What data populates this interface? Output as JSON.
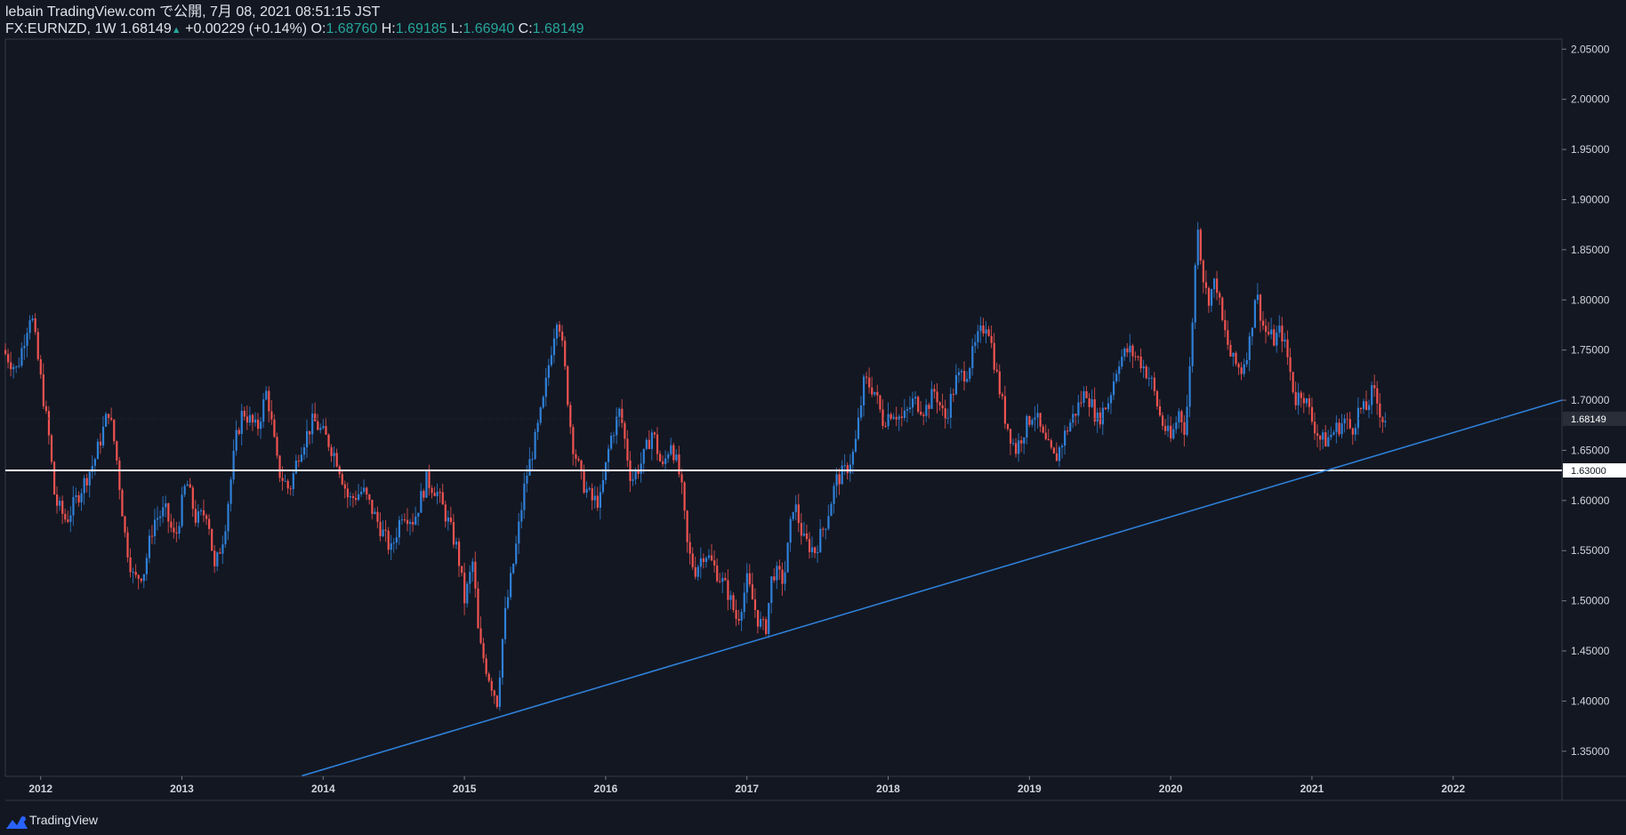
{
  "header": {
    "publish_line": "lebain TradingView.com で公開, 7月 08, 2021 08:51:15 JST",
    "symbol": "FX:EURNZD, 1W",
    "last": "1.68149",
    "change": "+0.00229 (+0.14%)",
    "o_label": "O:",
    "o_value": "1.68760",
    "h_label": "H:",
    "h_value": "1.69185",
    "l_label": "L:",
    "l_value": "1.66940",
    "c_label": "C:",
    "c_value": "1.68149"
  },
  "footer": {
    "brand": "TradingView",
    "brand_icon": "tradingview-logo-icon"
  },
  "colors": {
    "background": "#131722",
    "up": "#2f80d8",
    "down": "#ef5350",
    "trendline": "#2f80d8",
    "hline": "#ffffff",
    "text": "#d1d4dc",
    "accent": "#26a69a"
  },
  "chart_data": {
    "type": "candlestick",
    "y_scale": "linear",
    "ylim": [
      1.325,
      2.06
    ],
    "x_domain": [
      2011.75,
      2022.77
    ],
    "grid": false,
    "yticks": [
      "2.05000",
      "2.00000",
      "1.95000",
      "1.90000",
      "1.85000",
      "1.80000",
      "1.75000",
      "1.70000",
      "1.65000",
      "1.60000",
      "1.55000",
      "1.50000",
      "1.45000",
      "1.40000",
      "1.35000"
    ],
    "ytick_values": [
      2.05,
      2.0,
      1.95,
      1.9,
      1.85,
      1.8,
      1.75,
      1.7,
      1.65,
      1.6,
      1.55,
      1.5,
      1.45,
      1.4,
      1.35
    ],
    "xticks": [
      "2012",
      "2013",
      "2014",
      "2015",
      "2016",
      "2017",
      "2018",
      "2019",
      "2020",
      "2021",
      "2022"
    ],
    "xtick_values": [
      2012,
      2013,
      2014,
      2015,
      2016,
      2017,
      2018,
      2019,
      2020,
      2021,
      2022
    ],
    "last_price": 1.68149,
    "last_price_label": "1.68149",
    "horizontal_line": {
      "price": 1.63,
      "label": "1.63000"
    },
    "trendline": {
      "x1": 2013.85,
      "y1": 1.3255,
      "x2": 2022.77,
      "y2": 1.7
    },
    "price_path": [
      [
        2011.75,
        1.75
      ],
      [
        2011.85,
        1.73
      ],
      [
        2011.95,
        1.79
      ],
      [
        2012.02,
        1.72
      ],
      [
        2012.08,
        1.66
      ],
      [
        2012.12,
        1.6
      ],
      [
        2012.2,
        1.58
      ],
      [
        2012.3,
        1.61
      ],
      [
        2012.4,
        1.64
      ],
      [
        2012.5,
        1.69
      ],
      [
        2012.55,
        1.65
      ],
      [
        2012.62,
        1.56
      ],
      [
        2012.68,
        1.52
      ],
      [
        2012.75,
        1.53
      ],
      [
        2012.82,
        1.58
      ],
      [
        2012.9,
        1.59
      ],
      [
        2012.97,
        1.56
      ],
      [
        2013.05,
        1.62
      ],
      [
        2013.12,
        1.58
      ],
      [
        2013.2,
        1.59
      ],
      [
        2013.25,
        1.53
      ],
      [
        2013.32,
        1.57
      ],
      [
        2013.4,
        1.66
      ],
      [
        2013.45,
        1.69
      ],
      [
        2013.55,
        1.67
      ],
      [
        2013.62,
        1.71
      ],
      [
        2013.7,
        1.63
      ],
      [
        2013.78,
        1.61
      ],
      [
        2013.85,
        1.65
      ],
      [
        2013.95,
        1.68
      ],
      [
        2014.05,
        1.66
      ],
      [
        2014.12,
        1.64
      ],
      [
        2014.2,
        1.6
      ],
      [
        2014.3,
        1.61
      ],
      [
        2014.4,
        1.58
      ],
      [
        2014.5,
        1.55
      ],
      [
        2014.58,
        1.59
      ],
      [
        2014.66,
        1.58
      ],
      [
        2014.75,
        1.62
      ],
      [
        2014.82,
        1.61
      ],
      [
        2014.9,
        1.58
      ],
      [
        2014.97,
        1.55
      ],
      [
        2015.02,
        1.5
      ],
      [
        2015.08,
        1.54
      ],
      [
        2015.12,
        1.46
      ],
      [
        2015.18,
        1.43
      ],
      [
        2015.25,
        1.4
      ],
      [
        2015.3,
        1.48
      ],
      [
        2015.38,
        1.55
      ],
      [
        2015.45,
        1.62
      ],
      [
        2015.52,
        1.66
      ],
      [
        2015.58,
        1.7
      ],
      [
        2015.62,
        1.74
      ],
      [
        2015.68,
        1.79
      ],
      [
        2015.73,
        1.73
      ],
      [
        2015.78,
        1.66
      ],
      [
        2015.85,
        1.62
      ],
      [
        2015.92,
        1.6
      ],
      [
        2015.98,
        1.6
      ],
      [
        2016.05,
        1.66
      ],
      [
        2016.12,
        1.69
      ],
      [
        2016.2,
        1.62
      ],
      [
        2016.28,
        1.64
      ],
      [
        2016.35,
        1.67
      ],
      [
        2016.42,
        1.63
      ],
      [
        2016.48,
        1.66
      ],
      [
        2016.55,
        1.62
      ],
      [
        2016.6,
        1.55
      ],
      [
        2016.65,
        1.53
      ],
      [
        2016.72,
        1.55
      ],
      [
        2016.8,
        1.53
      ],
      [
        2016.88,
        1.51
      ],
      [
        2016.95,
        1.48
      ],
      [
        2017.02,
        1.52
      ],
      [
        2017.1,
        1.48
      ],
      [
        2017.15,
        1.47
      ],
      [
        2017.2,
        1.53
      ],
      [
        2017.28,
        1.52
      ],
      [
        2017.35,
        1.6
      ],
      [
        2017.42,
        1.56
      ],
      [
        2017.5,
        1.55
      ],
      [
        2017.58,
        1.58
      ],
      [
        2017.65,
        1.62
      ],
      [
        2017.72,
        1.63
      ],
      [
        2017.78,
        1.65
      ],
      [
        2017.85,
        1.72
      ],
      [
        2017.92,
        1.71
      ],
      [
        2017.98,
        1.68
      ],
      [
        2018.05,
        1.69
      ],
      [
        2018.12,
        1.68
      ],
      [
        2018.2,
        1.7
      ],
      [
        2018.28,
        1.69
      ],
      [
        2018.35,
        1.71
      ],
      [
        2018.42,
        1.68
      ],
      [
        2018.5,
        1.72
      ],
      [
        2018.58,
        1.73
      ],
      [
        2018.65,
        1.76
      ],
      [
        2018.72,
        1.78
      ],
      [
        2018.78,
        1.73
      ],
      [
        2018.85,
        1.68
      ],
      [
        2018.92,
        1.65
      ],
      [
        2018.98,
        1.67
      ],
      [
        2019.05,
        1.69
      ],
      [
        2019.12,
        1.66
      ],
      [
        2019.2,
        1.64
      ],
      [
        2019.28,
        1.67
      ],
      [
        2019.35,
        1.69
      ],
      [
        2019.42,
        1.71
      ],
      [
        2019.5,
        1.68
      ],
      [
        2019.58,
        1.7
      ],
      [
        2019.65,
        1.74
      ],
      [
        2019.72,
        1.75
      ],
      [
        2019.8,
        1.74
      ],
      [
        2019.88,
        1.72
      ],
      [
        2019.95,
        1.68
      ],
      [
        2020.02,
        1.66
      ],
      [
        2020.08,
        1.69
      ],
      [
        2020.12,
        1.67
      ],
      [
        2020.15,
        1.72
      ],
      [
        2020.18,
        1.8
      ],
      [
        2020.21,
        1.88
      ],
      [
        2020.24,
        1.83
      ],
      [
        2020.28,
        1.8
      ],
      [
        2020.34,
        1.82
      ],
      [
        2020.38,
        1.78
      ],
      [
        2020.45,
        1.74
      ],
      [
        2020.52,
        1.73
      ],
      [
        2020.58,
        1.76
      ],
      [
        2020.62,
        1.81
      ],
      [
        2020.68,
        1.77
      ],
      [
        2020.75,
        1.76
      ],
      [
        2020.8,
        1.77
      ],
      [
        2020.85,
        1.74
      ],
      [
        2020.9,
        1.7
      ],
      [
        2020.95,
        1.71
      ],
      [
        2021.02,
        1.68
      ],
      [
        2021.08,
        1.66
      ],
      [
        2021.12,
        1.66
      ],
      [
        2021.18,
        1.67
      ],
      [
        2021.25,
        1.68
      ],
      [
        2021.3,
        1.67
      ],
      [
        2021.35,
        1.69
      ],
      [
        2021.4,
        1.69
      ],
      [
        2021.45,
        1.71
      ],
      [
        2021.52,
        1.68149
      ]
    ]
  }
}
